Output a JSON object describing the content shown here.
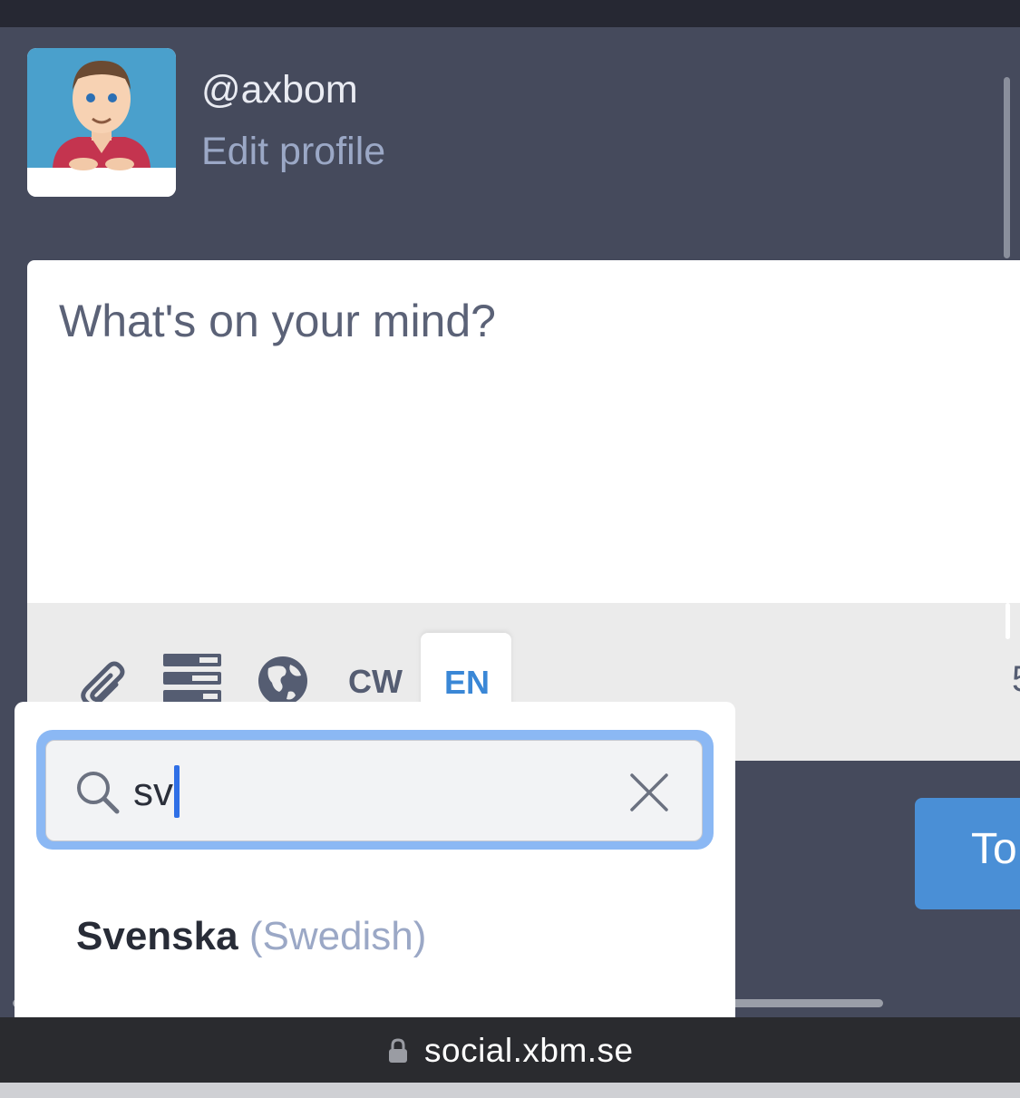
{
  "profile": {
    "handle": "@axbom",
    "edit_link": "Edit profile"
  },
  "composer": {
    "placeholder": "What's on your mind?",
    "cw_label": "CW",
    "language_code": "EN",
    "char_counter": "5",
    "submit_label": "To"
  },
  "icons": {
    "attach": "paperclip-icon",
    "poll": "poll-icon",
    "visibility": "globe-icon",
    "search": "search-icon",
    "clear": "close-icon",
    "lock": "lock-icon"
  },
  "language_dropdown": {
    "search_value": "sv",
    "results": [
      {
        "native": "Svenska",
        "english": "(Swedish)"
      }
    ]
  },
  "browser": {
    "url": "social.xbm.se"
  },
  "colors": {
    "background": "#454a5c",
    "accent": "#4a8fd6",
    "muted_link": "#9ba8c6",
    "focus_ring": "#8bb8f4"
  }
}
